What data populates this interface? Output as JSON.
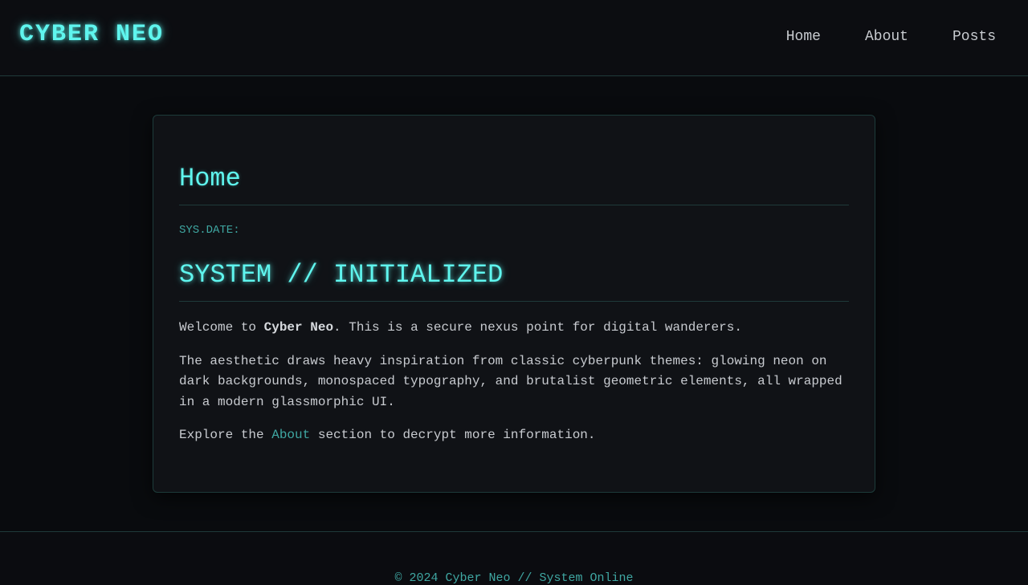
{
  "site": {
    "logo": "CYBER NEO"
  },
  "nav": {
    "items": [
      {
        "label": "Home"
      },
      {
        "label": "About"
      },
      {
        "label": "Posts"
      }
    ]
  },
  "page": {
    "title": "Home",
    "sysdate_label": "SYS.DATE:"
  },
  "post": {
    "heading": "SYSTEM // INITIALIZED",
    "p1": {
      "before": "Welcome to ",
      "bold": "Cyber Neo",
      "after": ". This is a secure nexus point for digital wanderers."
    },
    "p2": "The aesthetic draws heavy inspiration from classic cyberpunk themes: glowing neon on dark backgrounds, monospaced typography, and brutalist geometric elements, all wrapped in a modern glassmorphic UI.",
    "p3": {
      "before": "Explore the ",
      "link": "About",
      "after": " section to decrypt more information."
    }
  },
  "footer": {
    "text": "© 2024 Cyber Neo // System Online"
  },
  "colors": {
    "accent": "#5ff5ee",
    "accent_dim": "#3fa7a2",
    "background": "#0b0c10",
    "card": "#101216",
    "text": "#c8cbd0"
  }
}
